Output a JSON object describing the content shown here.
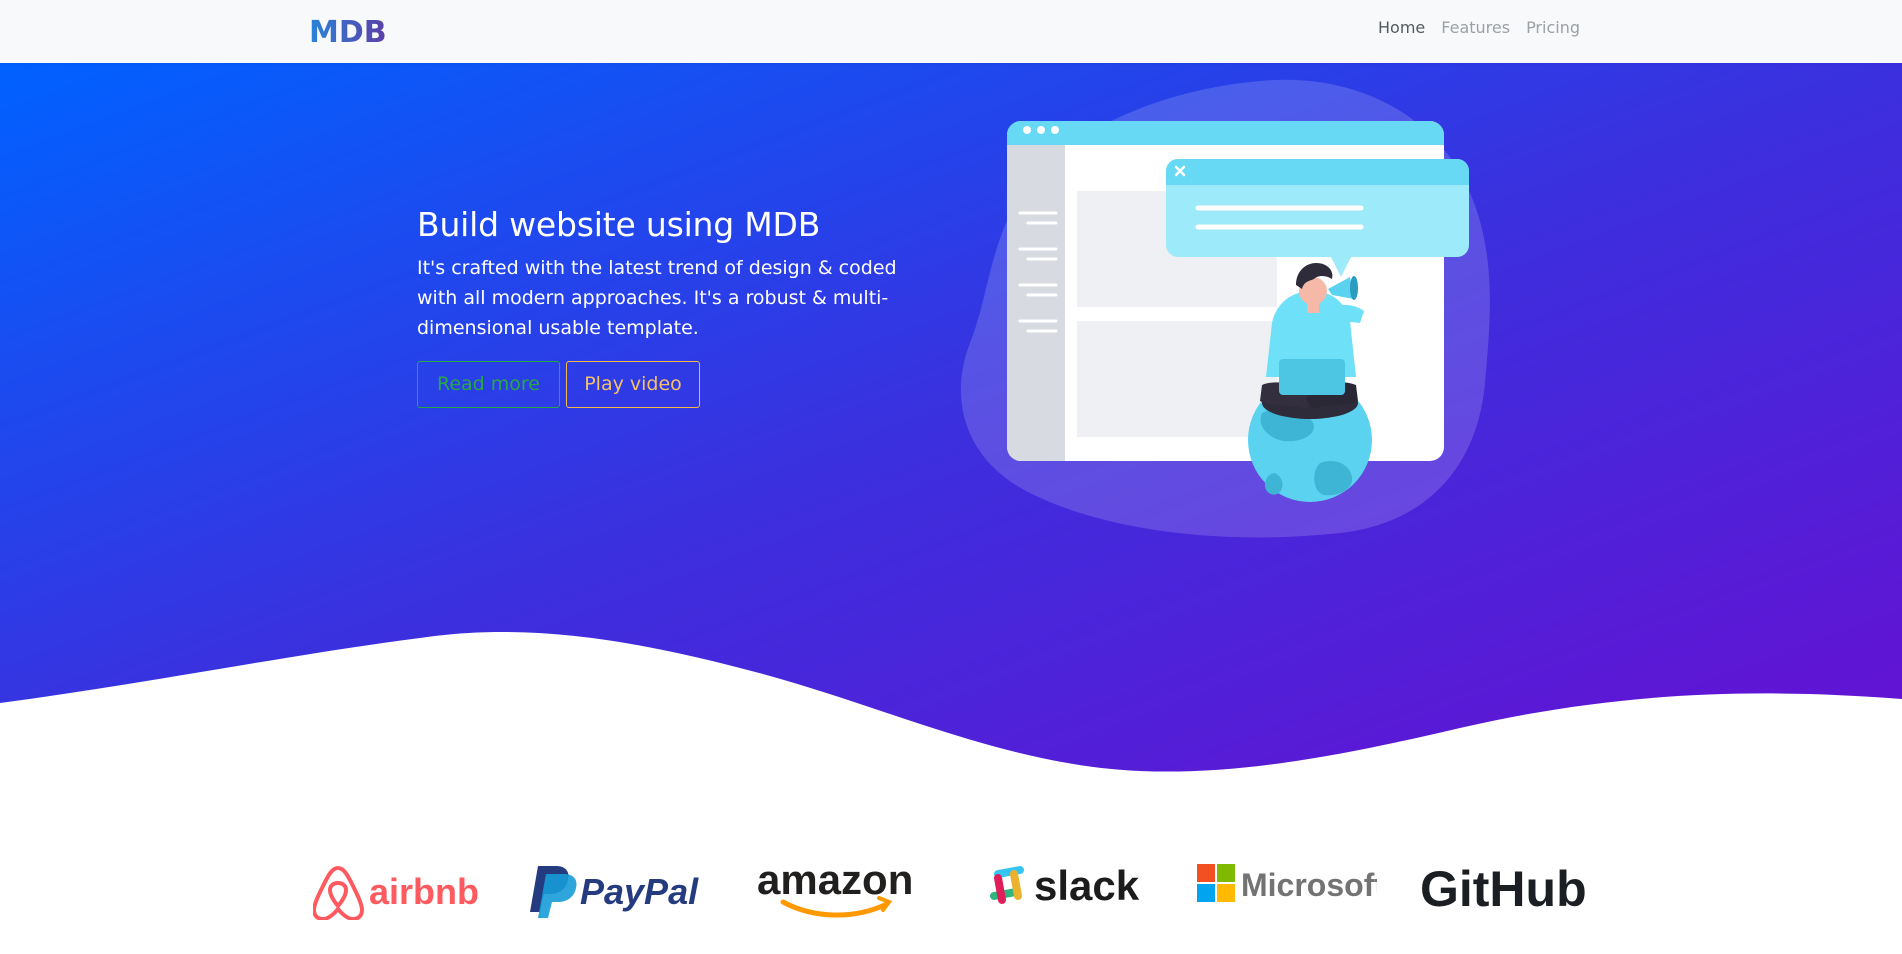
{
  "navbar": {
    "logo_text": "MDB",
    "links": [
      {
        "label": "Home",
        "active": true
      },
      {
        "label": "Features",
        "active": false
      },
      {
        "label": "Pricing",
        "active": false
      }
    ]
  },
  "hero": {
    "title": "Build website using MDB",
    "description": "It's crafted with the latest trend of design & coded with all modern approaches. It's a robust & multi-dimensional usable template.",
    "read_more_label": "Read more",
    "play_video_label": "Play video",
    "gradient_start": "#0062ff",
    "gradient_end": "#6610d2"
  },
  "brands": [
    {
      "name": "airbnb",
      "color": "#ff5a5f"
    },
    {
      "name": "PayPal",
      "color": "#253b80"
    },
    {
      "name": "amazon",
      "color": "#221f1f"
    },
    {
      "name": "slack",
      "color": "#1d1c1d"
    },
    {
      "name": "Microsoft",
      "color": "#737373"
    },
    {
      "name": "GitHub",
      "color": "#1b1f23"
    }
  ]
}
